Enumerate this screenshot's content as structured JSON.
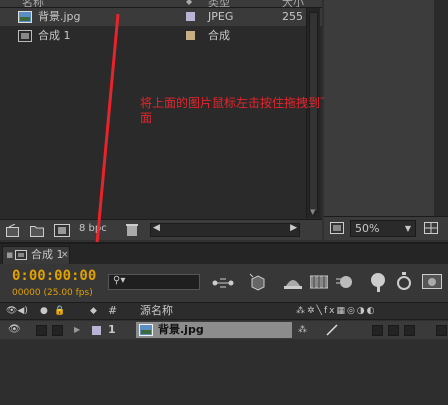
{
  "project": {
    "columns": {
      "name": "名称",
      "type": "类型",
      "size": "大小"
    },
    "items": [
      {
        "name": "背景.jpg",
        "type": "JPEG",
        "size": "255",
        "label_color": "#b9b3d6"
      },
      {
        "name": "合成 1",
        "type": "合成",
        "size": "",
        "label_color": "#c8b083"
      }
    ],
    "bpc": "8 bpc"
  },
  "viewer": {
    "zoom": "50%"
  },
  "annotation": {
    "text": "将上面的图片鼠标左击按住拖拽到下面",
    "color": "#e8242a"
  },
  "timeline": {
    "tab_label": "合成 1",
    "timecode": "0:00:00:00",
    "fps": "00000 (25.00 fps)",
    "search_placeholder": "",
    "header": {
      "number": "#",
      "source_name": "源名称"
    },
    "layers": [
      {
        "index": "1",
        "name": "背景.jpg",
        "label_color": "#b9b3d6"
      }
    ]
  }
}
